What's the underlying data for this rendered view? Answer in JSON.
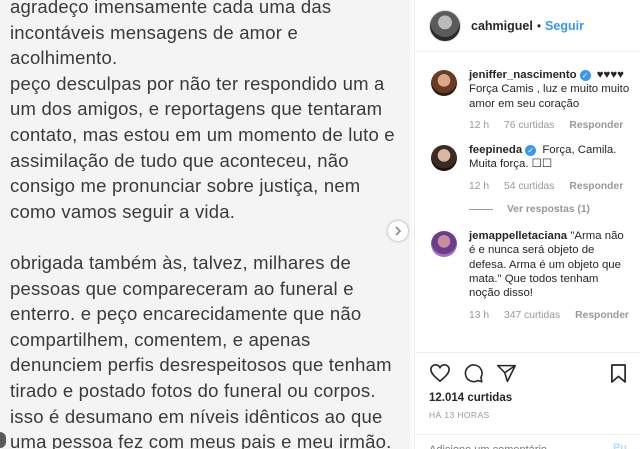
{
  "post": {
    "lines": [
      "agradeço imensamente cada uma das",
      "incontáveis mensagens de amor e",
      "acolhimento.",
      "peço desculpas por não ter respondido um a",
      "um dos amigos, e reportagens que tentaram",
      "contato, mas estou em um momento de luto e",
      "assimilação de tudo que aconteceu, não",
      "consigo me pronunciar sobre justiça, nem",
      "como vamos seguir a vida.",
      "",
      "obrigada também às, talvez, milhares de",
      "pessoas que compareceram ao funeral e",
      "enterro. e peço encarecidamente que não",
      "compartilhem, comentem, e apenas",
      "denunciem perfis desrespeitosos que tenham",
      "tirado e postado fotos do funeral ou corpos.",
      "isso é desumano em níveis idênticos ao que",
      "uma pessoa fez com meus pais e meu irmão."
    ],
    "next_icon": "chevron-right-icon"
  },
  "header": {
    "username": "cahmiguel",
    "dot": "•",
    "follow_label": "Seguir"
  },
  "comments": [
    {
      "username": "jeniffer_nascimento",
      "verified": true,
      "text": "♥♥♥♥ Força Camis , luz e muito muito amor em seu coração",
      "age": "12 h",
      "likes": "76 curtidas",
      "reply_label": "Responder"
    },
    {
      "username": "feepineda",
      "verified": true,
      "text": "Força, Camila. Muita força. ☐☐",
      "age": "12 h",
      "likes": "54 curtidas",
      "reply_label": "Responder",
      "view_replies": "Ver respostas (1)"
    },
    {
      "username": "jemappelletaciana",
      "verified": false,
      "text": "\"Arma não é e nunca será objeto de defesa. Arma é um objeto que mata.\" Que todos tenham noção disso!",
      "age": "13 h",
      "likes": "347 curtidas",
      "reply_label": "Responder"
    }
  ],
  "actions": {
    "icons": [
      "heart-icon",
      "comment-icon",
      "share-icon",
      "bookmark-icon"
    ],
    "likes": "12.014 curtidas",
    "time": "HÁ 13 HORAS"
  },
  "add_comment": {
    "placeholder": "Adicione um comentário...",
    "publish_label": "Pu"
  },
  "colors": {
    "link_blue": "#3897f0",
    "muted": "#999999",
    "verified_blue": "#3897f0"
  }
}
